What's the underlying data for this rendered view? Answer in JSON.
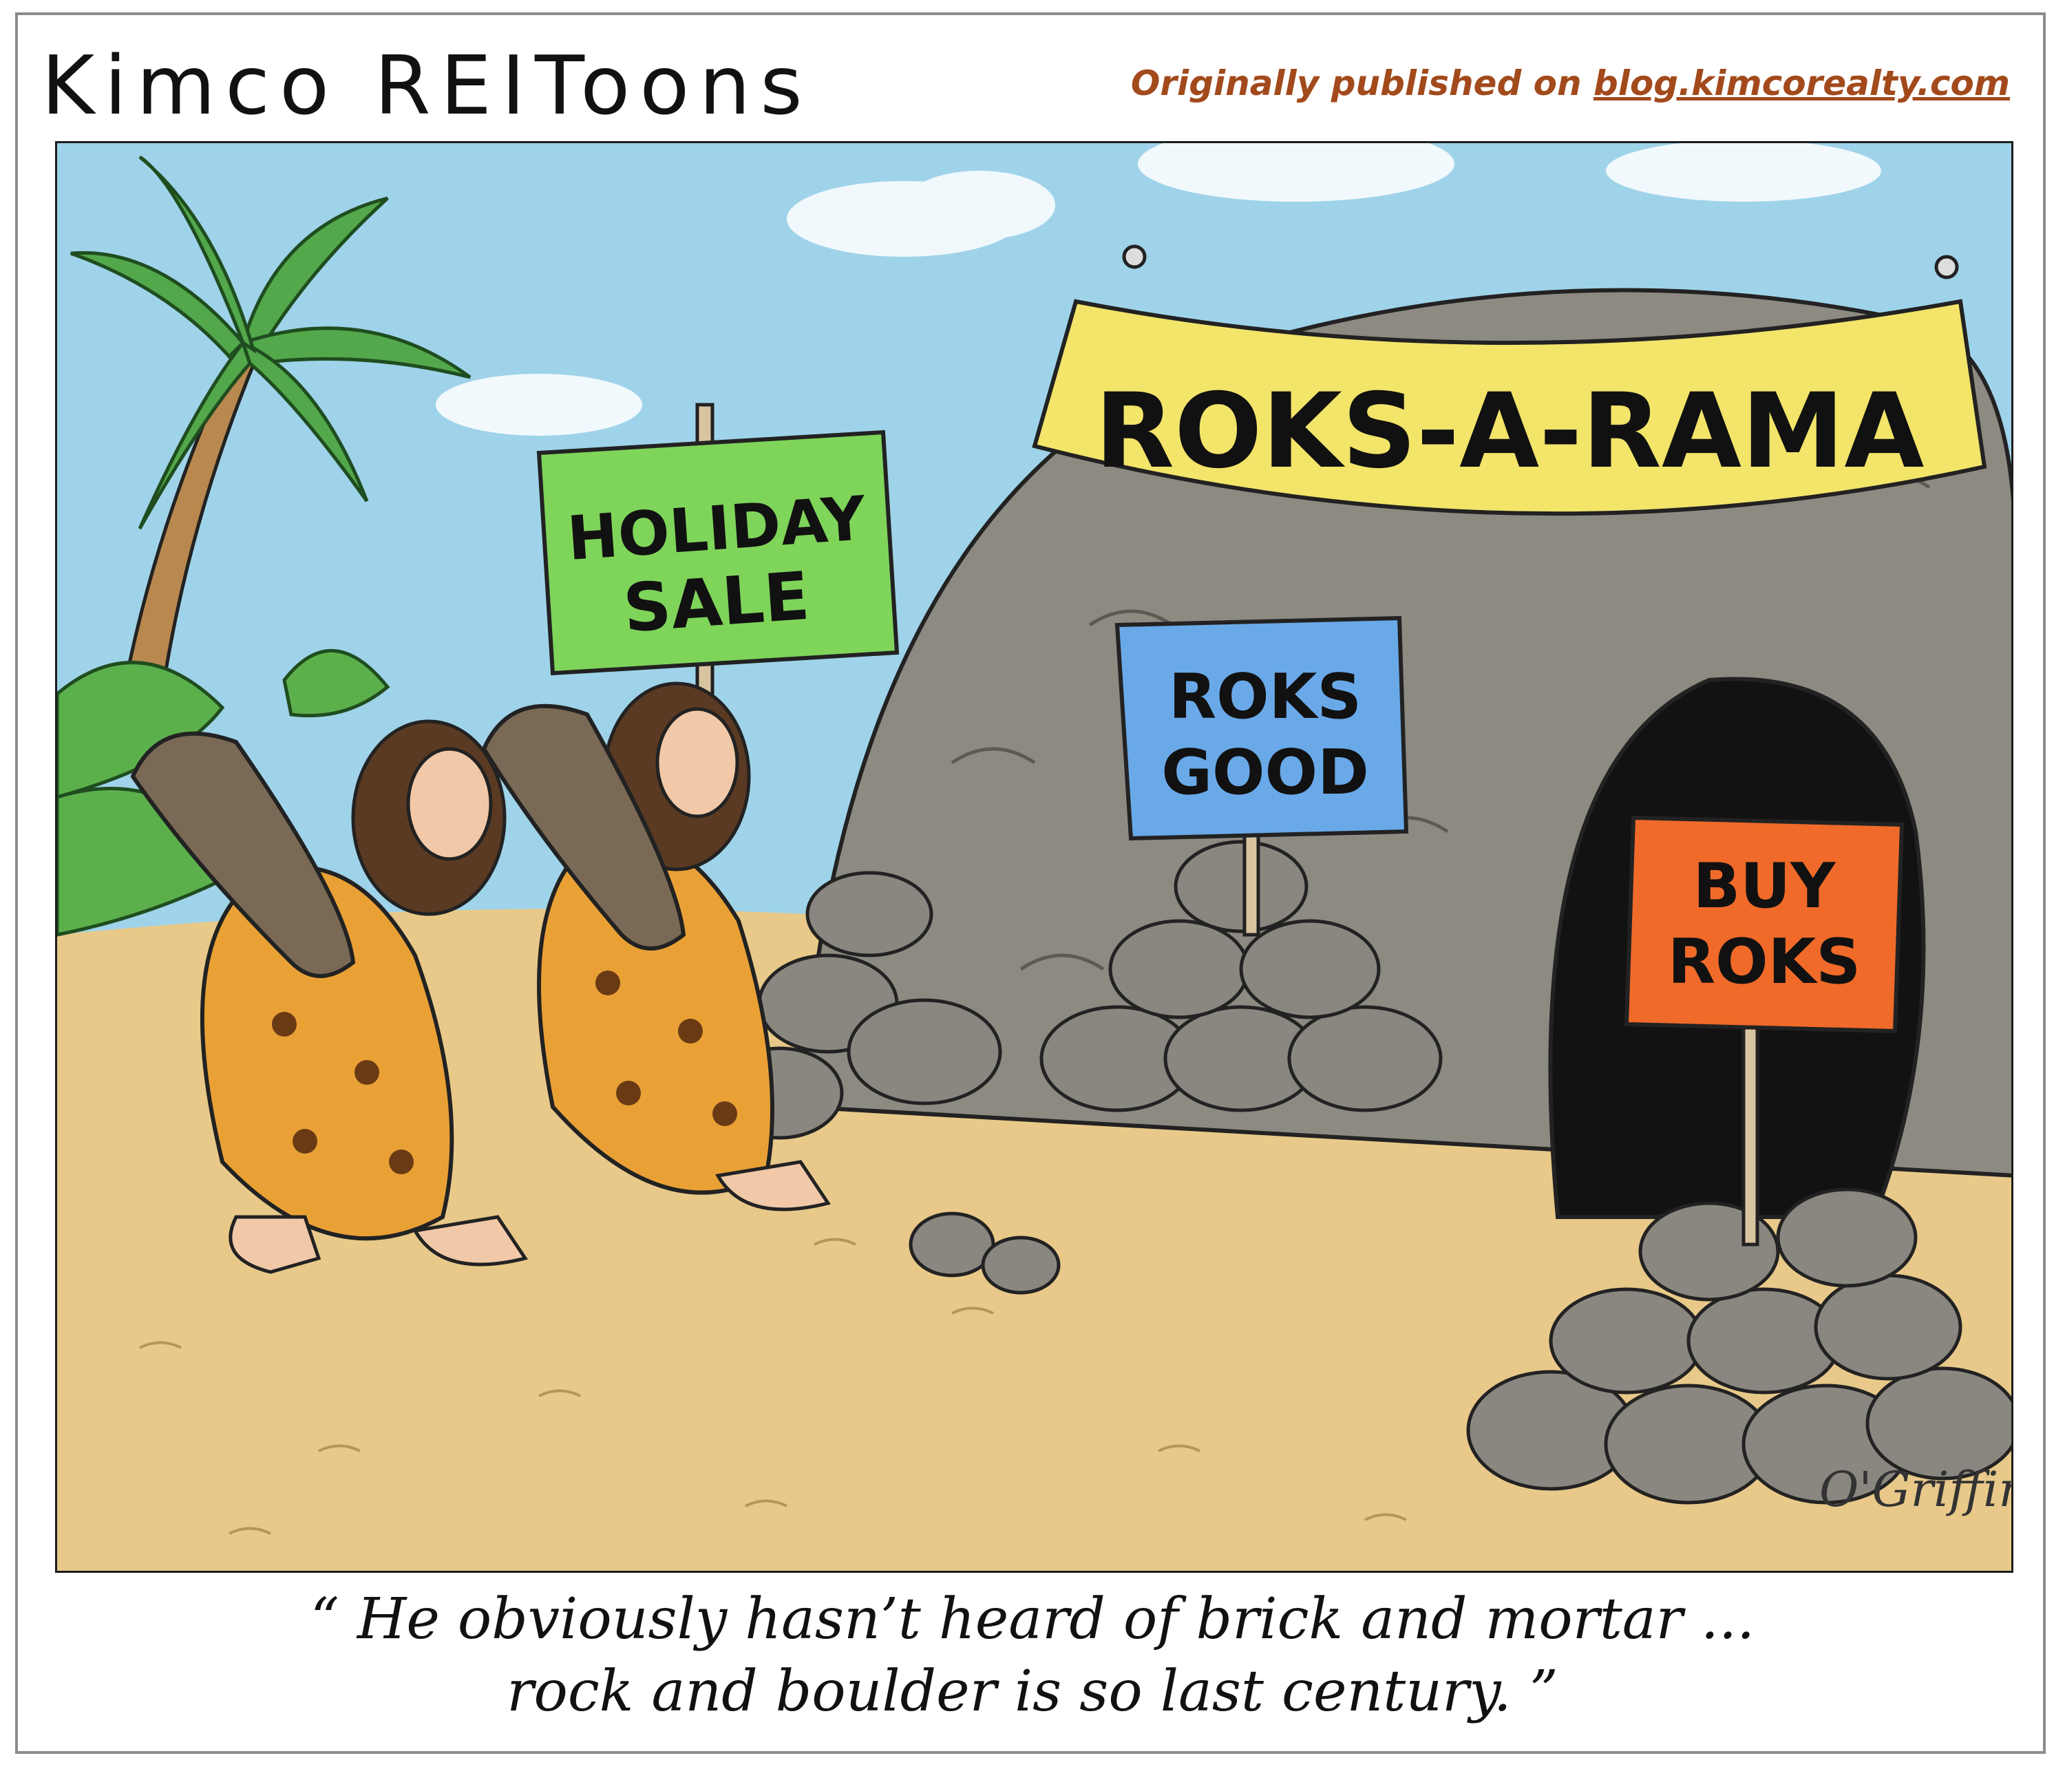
{
  "header": {
    "title": "Kimco REIToons",
    "byline_prefix": "Originally published on ",
    "byline_link": "blog.kimcorealty.com"
  },
  "cartoon": {
    "banner": "ROKS-A-RAMA",
    "holiday_sign": {
      "line1": "HOLIDAY",
      "line2": "SALE"
    },
    "blue_sign": {
      "line1": "ROKS",
      "line2": "GOOD"
    },
    "orange_sign": {
      "line1": "BUY",
      "line2": "ROKS"
    },
    "signature": "O'Griffin"
  },
  "caption": {
    "line1": "“ He obviously hasn’t heard of brick and mortar ...",
    "line2": "rock and boulder is so last century. ”"
  },
  "colors": {
    "sky": "#9fd3ea",
    "sand": "#e8c98a",
    "rock": "#8d8a82",
    "banner": "#f3e46a",
    "holiday_sign": "#7fd45a",
    "blue_sign": "#6aa9e8",
    "orange_sign": "#f06a2a",
    "tunic": "#e9a136",
    "byline": "#a24a1c"
  }
}
